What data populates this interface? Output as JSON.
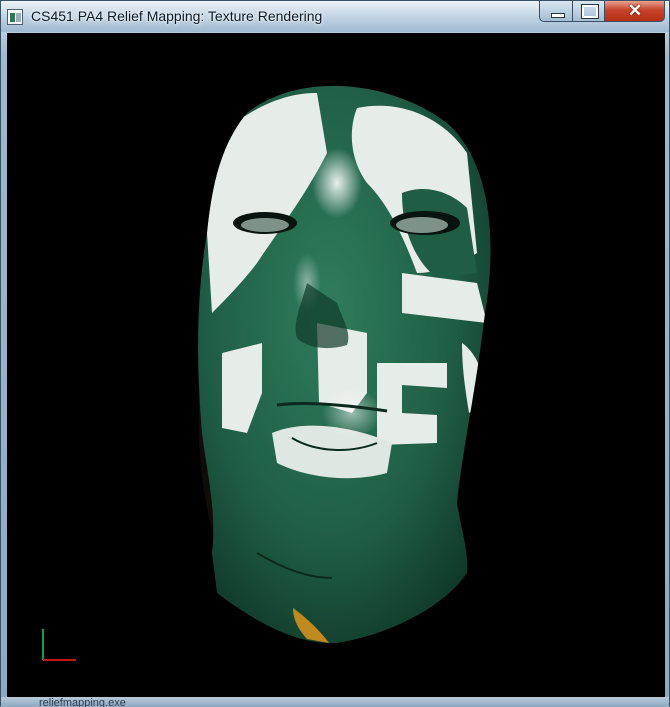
{
  "window": {
    "title": "CS451 PA4 Relief Mapping: Texture Rendering",
    "app_icon": "app-window-icon",
    "controls": {
      "minimize": "minimize-icon",
      "maximize": "maximize-icon",
      "close": "close-icon",
      "close_glyph": "✕"
    }
  },
  "viewport": {
    "background": "#000000",
    "model": "textured-head-model",
    "texture_colors": {
      "green": "#1f5e45",
      "white": "#e6ece8"
    },
    "axis_colors": {
      "x": "#c81414",
      "y": "#12a13a"
    }
  },
  "footer": {
    "text": "reliefmapping.exe"
  }
}
